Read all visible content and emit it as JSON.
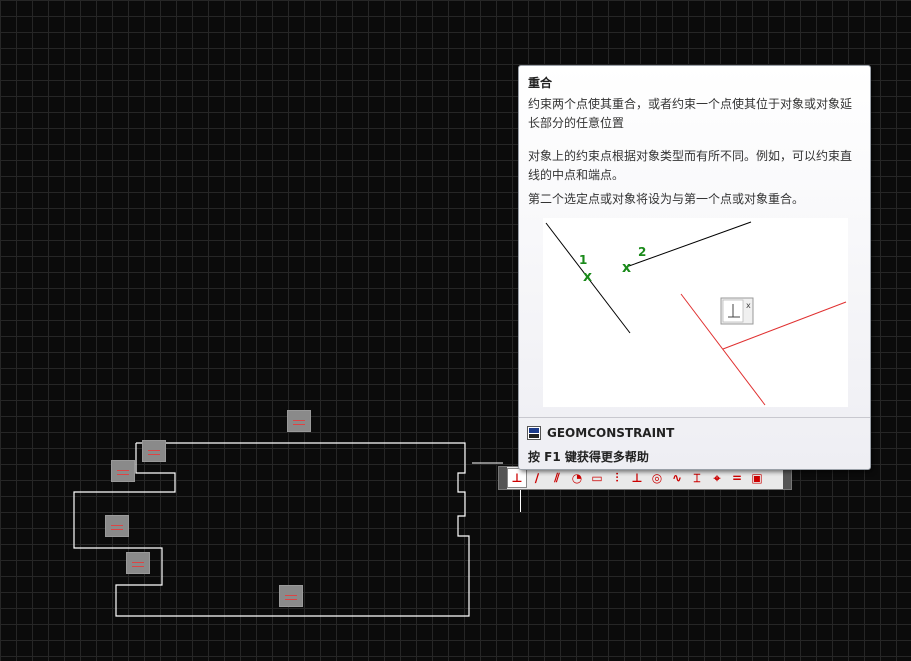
{
  "tooltip": {
    "title": "重合",
    "description1": "约束两个点使其重合，或者约束一个点使其位于对象或对象延长部分的任意位置",
    "description2": "对象上的约束点根据对象类型而有所不同。例如，可以约束直线的中点和端点。",
    "description3": "第二个选定点或对象将设为与第一个点或对象重合。",
    "illustration": {
      "label1": "1",
      "label2": "2",
      "marker": "x",
      "popup_close": "x"
    },
    "command_name": "GEOMCONSTRAINT",
    "command_icon": "command-window-icon",
    "help_hint": "按 F1 键获得更多帮助"
  },
  "toolbar": {
    "icons": [
      "coincident-icon",
      "collinear-icon",
      "parallel-icon",
      "tangent-icon",
      "horizontal-icon",
      "vertical-icon",
      "perpendicular-icon",
      "concentric-icon",
      "smooth-icon",
      "symmetric-icon",
      "fix-icon",
      "equal-icon",
      "lock-icon"
    ]
  },
  "colors": {
    "background": "#0b0b0b",
    "grid": "#262626",
    "geometry": "#ffffff",
    "constraint_marker": "#8a8a8a",
    "illustration_black": "#000000",
    "illustration_red": "#e03030",
    "illustration_green": "#1a8a1a"
  }
}
